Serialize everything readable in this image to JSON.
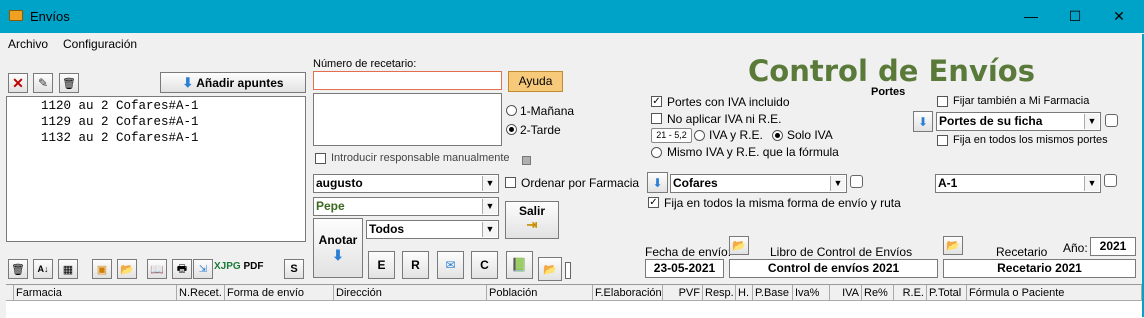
{
  "window": {
    "title": "Envíos",
    "minimize": "—",
    "maximize": "☐",
    "close": "✕"
  },
  "menu": {
    "items": [
      "Archivo",
      "Configuración"
    ]
  },
  "left": {
    "add_button": "Añadir apuntes",
    "list_items": [
      "1120 au 2 Cofares#A-1",
      "1129 au 2 Cofares#A-1",
      "1132 au 2 Cofares#A-1"
    ],
    "toolbar2_s": "S"
  },
  "recetario": {
    "label": "Número de recetario:",
    "value": "",
    "ayuda": "Ayuda",
    "radio_manana": "1-Mañana",
    "radio_tarde": "2-Tarde",
    "introducir_label": "Introducir responsable manualmente",
    "month_value": "augusto",
    "ordenar_label": "Ordenar por Farmacia",
    "person_value": "Pepe",
    "todos_value": "Todos",
    "salir": "Salir",
    "anotar": "Anotar",
    "btn_e": "E",
    "btn_r": "R",
    "btn_c": "C"
  },
  "control": {
    "title": "Control de Envíos",
    "portes_label": "Portes",
    "portes_iva": "Portes con IVA incluido",
    "no_aplicar": "No aplicar IVA ni R.E.",
    "tag": "21 - 5,2",
    "iva_re": "IVA y R.E.",
    "solo_iva": "Solo IVA",
    "mismo_iva": "Mismo IVA y R.E. que la fórmula",
    "fijar_mi_farmacia": "Fijar también a Mi Farmacia",
    "portes_select": "Portes de su ficha",
    "fija_mismos_portes": "Fija en todos los mismos portes",
    "transporte_select": "Cofares",
    "ruta_select": "A-1",
    "fija_forma_envio": "Fija en todos la misma forma de envío y ruta",
    "fecha_label": "Fecha de envío:",
    "fecha_value": "23-05-2021",
    "libro_label": "Libro de Control de Envíos",
    "libro_value": "Control de envíos 2021",
    "recetario_label": "Recetario",
    "recetario_value": "Recetario 2021",
    "anio_label": "Año:",
    "anio_value": "2021"
  },
  "grid": {
    "columns": [
      "Farmacia",
      "N.Recet.",
      "Forma de envío",
      "Dirección",
      "Población",
      "F.Elaboración",
      "PVF",
      "Resp.",
      "H.",
      "P.Base",
      "Iva%",
      "IVA",
      "Re%",
      "R.E.",
      "P.Total",
      "Fórmula o Paciente"
    ]
  },
  "colors": {
    "titlebar": "#00a3c8",
    "title_green": "#5a7a3a",
    "ayuda_bg": "#f7c97a",
    "blue_arrow": "#2a7fd4"
  }
}
